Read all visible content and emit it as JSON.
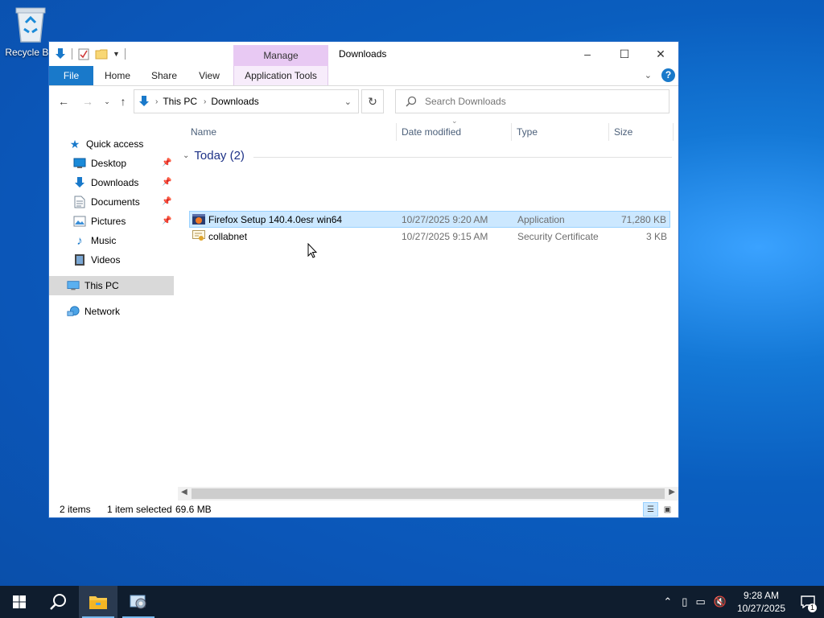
{
  "desktop": {
    "recycle_bin_label": "Recycle Bin"
  },
  "window": {
    "title": "Downloads",
    "contextual_tab_group": "Manage",
    "ribbon_tabs": [
      "File",
      "Home",
      "Share",
      "View",
      "Application Tools"
    ],
    "controls": {
      "minimize": "–",
      "maximize": "☐",
      "close": "✕"
    }
  },
  "navigation": {
    "breadcrumb": [
      "This PC",
      "Downloads"
    ],
    "search_placeholder": "Search Downloads"
  },
  "nav_pane": {
    "quick_access": "Quick access",
    "items": [
      {
        "label": "Desktop",
        "icon": "desktop-icon",
        "pinned": true
      },
      {
        "label": "Downloads",
        "icon": "downloads-icon",
        "pinned": true
      },
      {
        "label": "Documents",
        "icon": "documents-icon",
        "pinned": true
      },
      {
        "label": "Pictures",
        "icon": "pictures-icon",
        "pinned": true
      },
      {
        "label": "Music",
        "icon": "music-icon",
        "pinned": false
      },
      {
        "label": "Videos",
        "icon": "videos-icon",
        "pinned": false
      }
    ],
    "this_pc": "This PC",
    "network": "Network"
  },
  "file_list": {
    "columns": [
      "Name",
      "Date modified",
      "Type",
      "Size"
    ],
    "group_label": "Today (2)",
    "rows": [
      {
        "name": "Firefox Setup 140.4.0esr win64",
        "date": "10/27/2025 9:20 AM",
        "type": "Application",
        "size": "71,280 KB",
        "selected": true,
        "icon": "application-icon"
      },
      {
        "name": "collabnet",
        "date": "10/27/2025 9:15 AM",
        "type": "Security Certificate",
        "size": "3 KB",
        "selected": false,
        "icon": "certificate-icon"
      }
    ]
  },
  "status_bar": {
    "item_count": "2 items",
    "selection": "1 item selected",
    "selection_size": "69.6 MB"
  },
  "taskbar": {
    "time": "9:28 AM",
    "date": "10/27/2025",
    "notification_count": "1"
  },
  "colors": {
    "accent": "#1979ca",
    "selection_bg": "#cce8ff",
    "manage_tab": "#e8c9f3",
    "group_header": "#1e3287"
  }
}
